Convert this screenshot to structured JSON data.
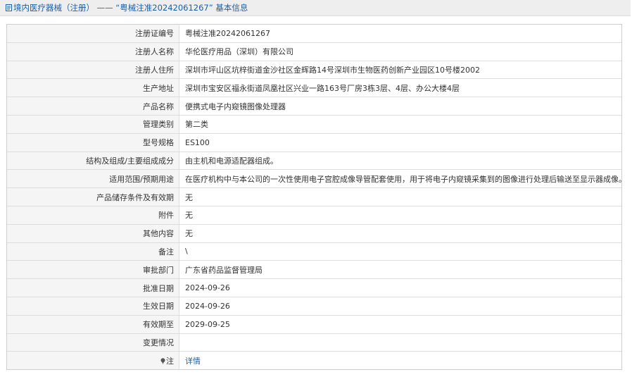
{
  "header": {
    "title": "境内医疗器械（注册） —— “粤械注准20242061267” 基本信息"
  },
  "rows": [
    {
      "label": "注册证编号",
      "value": "粤械注准20242061267"
    },
    {
      "label": "注册人名称",
      "value": "华伦医疗用品（深圳）有限公司"
    },
    {
      "label": "注册人住所",
      "value": "深圳市坪山区坑梓街道金沙社区金辉路14号深圳市生物医药创新产业园区10号楼2002"
    },
    {
      "label": "生产地址",
      "value": "深圳市宝安区福永街道凤凰社区兴业一路163号厂房3栋3层、4层、办公大楼4层"
    },
    {
      "label": "产品名称",
      "value": "便携式电子内窥镜图像处理器"
    },
    {
      "label": "管理类别",
      "value": "第二类"
    },
    {
      "label": "型号规格",
      "value": "ES100"
    },
    {
      "label": "结构及组成/主要组成成分",
      "value": "由主机和电源适配器组成。"
    },
    {
      "label": "适用范围/预期用途",
      "value": "在医疗机构中与本公司的一次性使用电子宫腔成像导管配套使用，用于将电子内窥镜采集到的图像进行处理后输送至显示器成像。"
    },
    {
      "label": "产品储存条件及有效期",
      "value": "无"
    },
    {
      "label": "附件",
      "value": "无"
    },
    {
      "label": "其他内容",
      "value": "无"
    },
    {
      "label": "备注",
      "value": "\\"
    },
    {
      "label": "审批部门",
      "value": "广东省药品监督管理局"
    },
    {
      "label": "批准日期",
      "value": "2024-09-26"
    },
    {
      "label": "生效日期",
      "value": "2024-09-26"
    },
    {
      "label": "有效期至",
      "value": "2029-09-25"
    },
    {
      "label": "变更情况",
      "value": ""
    }
  ],
  "note_row": {
    "label": "注",
    "link": "详情"
  },
  "colors": {
    "title_blue": "#1a5fa8",
    "label_bg": "#f5f5f5",
    "border": "#dddddd"
  }
}
